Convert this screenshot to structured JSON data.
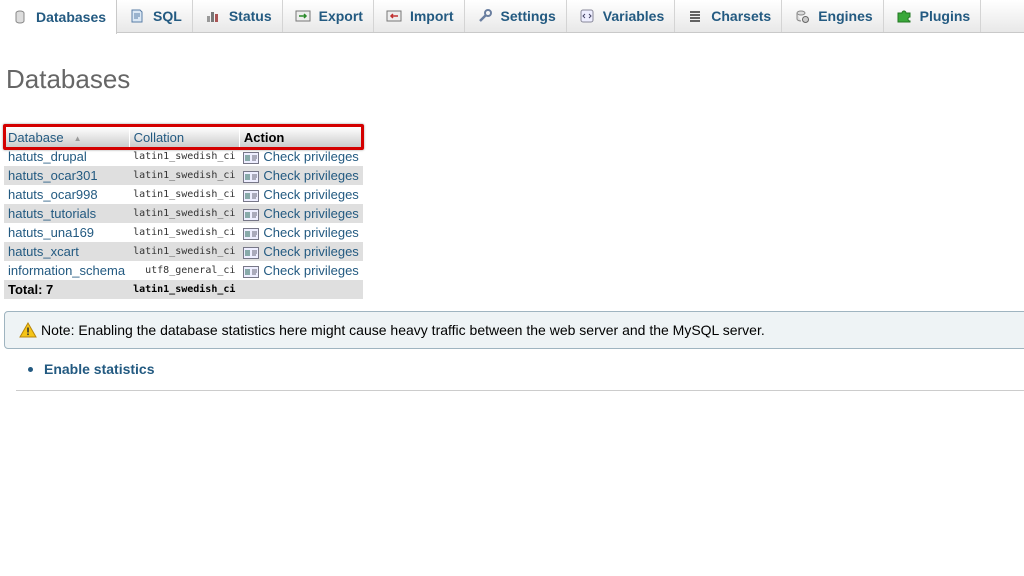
{
  "tabs": [
    {
      "label": "Databases",
      "icon": "database-icon",
      "active": true
    },
    {
      "label": "SQL",
      "icon": "sql-icon"
    },
    {
      "label": "Status",
      "icon": "status-icon"
    },
    {
      "label": "Export",
      "icon": "export-icon"
    },
    {
      "label": "Import",
      "icon": "import-icon"
    },
    {
      "label": "Settings",
      "icon": "wrench-icon"
    },
    {
      "label": "Variables",
      "icon": "variables-icon"
    },
    {
      "label": "Charsets",
      "icon": "charsets-icon"
    },
    {
      "label": "Engines",
      "icon": "engines-icon"
    },
    {
      "label": "Plugins",
      "icon": "puzzle-icon"
    }
  ],
  "page_title": "Databases",
  "table": {
    "headers": {
      "database": "Database",
      "collation": "Collation",
      "action": "Action"
    },
    "rows": [
      {
        "name": "hatuts_drupal",
        "collation": "latin1_swedish_ci",
        "action": "Check privileges"
      },
      {
        "name": "hatuts_ocar301",
        "collation": "latin1_swedish_ci",
        "action": "Check privileges"
      },
      {
        "name": "hatuts_ocar998",
        "collation": "latin1_swedish_ci",
        "action": "Check privileges"
      },
      {
        "name": "hatuts_tutorials",
        "collation": "latin1_swedish_ci",
        "action": "Check privileges"
      },
      {
        "name": "hatuts_una169",
        "collation": "latin1_swedish_ci",
        "action": "Check privileges"
      },
      {
        "name": "hatuts_xcart",
        "collation": "latin1_swedish_ci",
        "action": "Check privileges"
      },
      {
        "name": "information_schema",
        "collation": "utf8_general_ci",
        "action": "Check privileges"
      }
    ],
    "total_label": "Total: 7",
    "total_collation": "latin1_swedish_ci"
  },
  "note": "Note: Enabling the database statistics here might cause heavy traffic between the web server and the MySQL server.",
  "enable_statistics": "Enable statistics",
  "colors": {
    "link": "#235a81",
    "highlight": "#d40000"
  }
}
